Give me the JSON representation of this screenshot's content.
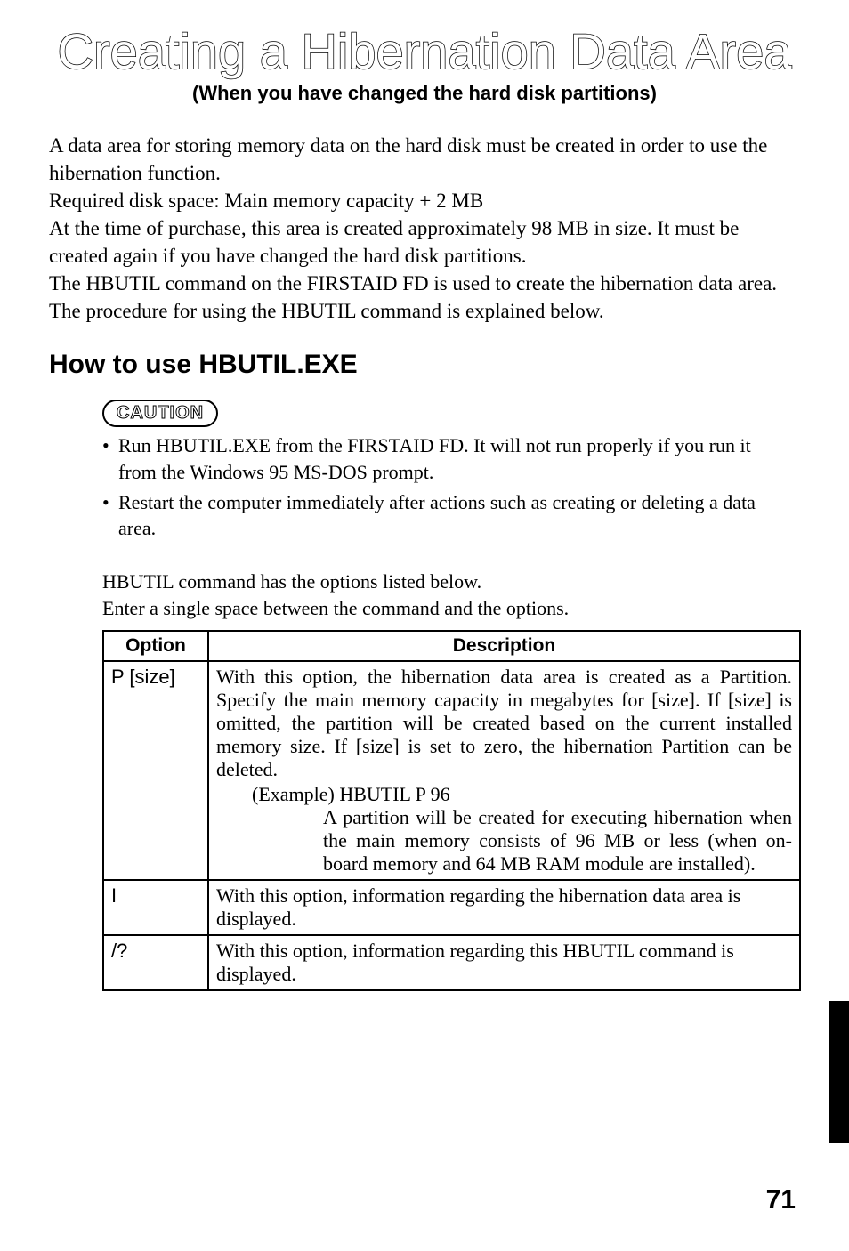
{
  "title": "Creating a Hibernation Data Area",
  "subtitle": "(When you have changed the hard disk partitions)",
  "intro": "A data area for storing memory data on the hard disk must be created in order to use the hibernation function.\nRequired disk space: Main memory capacity + 2 MB\nAt the time of purchase, this area is created approximately 98 MB in size. It must be created again if you have changed the hard disk partitions.\nThe HBUTIL command on the FIRSTAID FD is used to create the hibernation data area. The procedure for using the HBUTIL command is explained below.",
  "section_heading": "How to use HBUTIL.EXE",
  "caution_label": "CAUTION",
  "caution_items": [
    "Run HBUTIL.EXE from the FIRSTAID FD. It will not run properly if you run it from the Windows 95 MS-DOS prompt.",
    "Restart the computer immediately after actions such as creating or deleting a data area."
  ],
  "table_intro": "HBUTIL command has the options listed below.\nEnter a single space between the command and the options.",
  "table": {
    "headers": [
      "Option",
      "Description"
    ],
    "rows": [
      {
        "option": "P [size]",
        "desc_main": "With this option, the hibernation data area is created as a Partition. Specify the main memory capacity in megabytes for [size]. If [size] is omitted, the partition will be created based on the current installed memory size. If [size] is set to zero, the hibernation Partition can be deleted.",
        "example_label": "(Example)  HBUTIL  P  96",
        "example_note": "A partition will be created for executing hibernation when the main memory consists of 96 MB or less (when on-board memory and 64 MB RAM module are installed)."
      },
      {
        "option": "I",
        "desc_main": "With this option, information regarding the hibernation data area is displayed."
      },
      {
        "option": "/?",
        "desc_main": "With this option, information regarding this HBUTIL command is displayed."
      }
    ]
  },
  "page_number": "71"
}
